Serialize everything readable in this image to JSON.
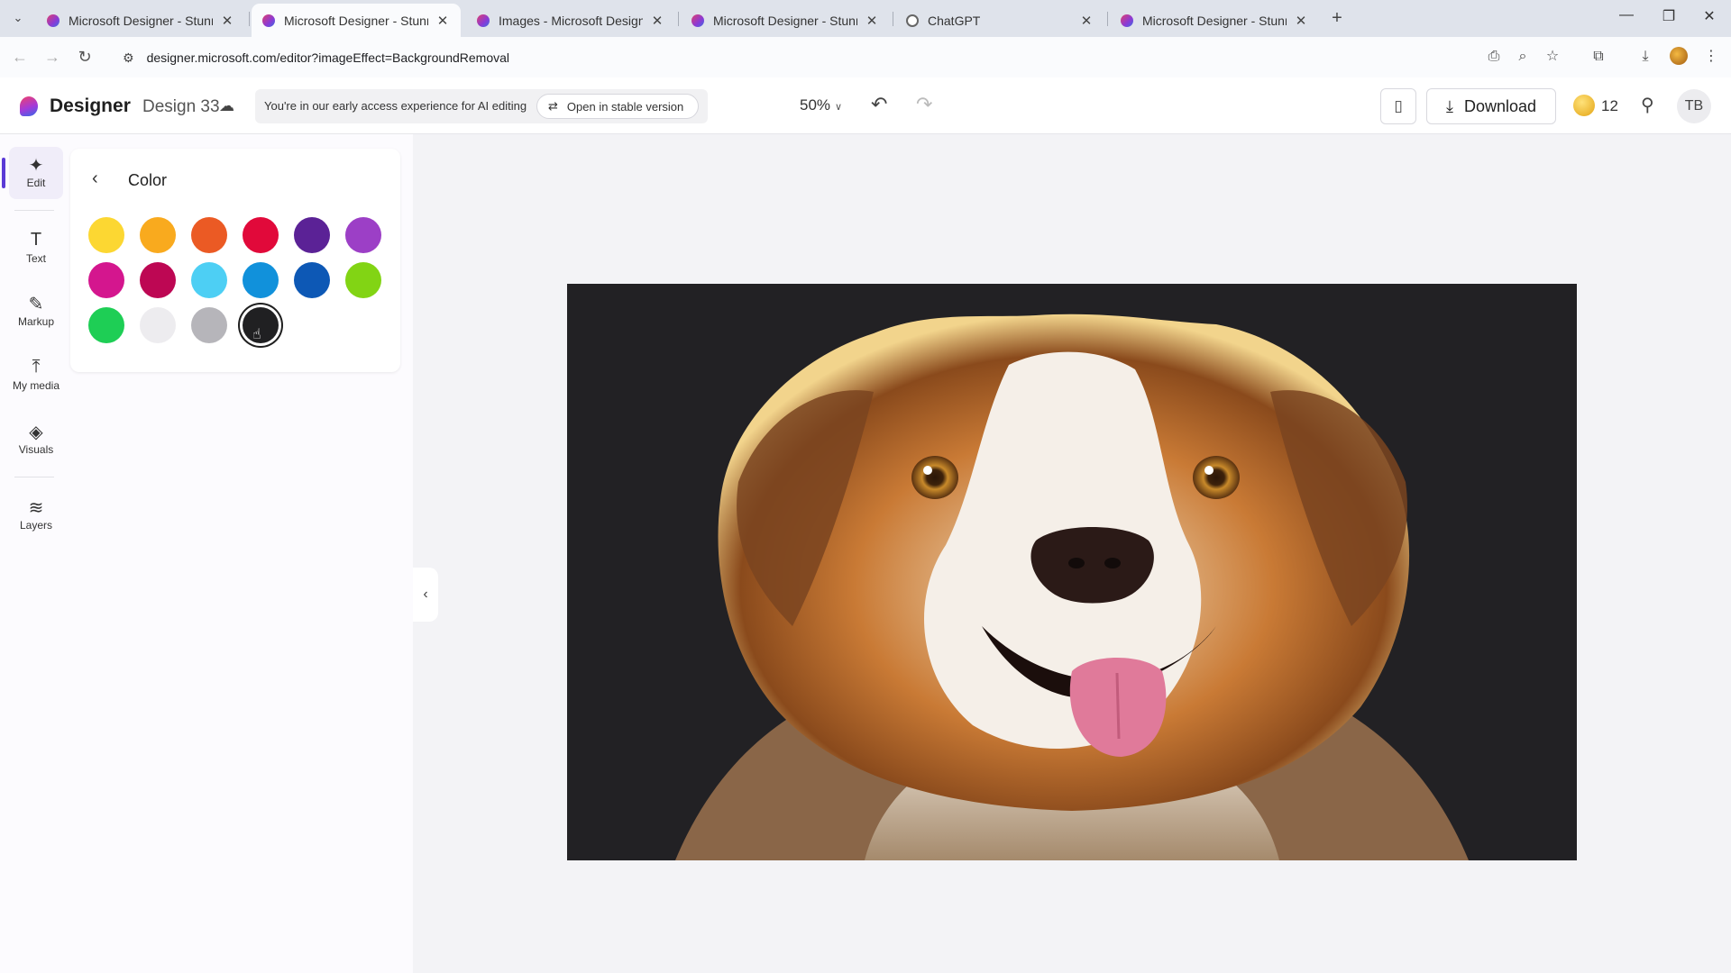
{
  "browser": {
    "tabs": [
      {
        "title": "Microsoft Designer - Stunning",
        "favicon": "designer",
        "active": false
      },
      {
        "title": "Microsoft Designer - Stunning",
        "favicon": "designer",
        "active": true
      },
      {
        "title": "Images - Microsoft Designer",
        "favicon": "designer",
        "active": false
      },
      {
        "title": "Microsoft Designer - Stunning",
        "favicon": "designer",
        "active": false
      },
      {
        "title": "ChatGPT",
        "favicon": "chatgpt",
        "active": false
      },
      {
        "title": "Microsoft Designer - Stunning",
        "favicon": "designer",
        "active": false
      }
    ],
    "url": "designer.microsoft.com/editor?imageEffect=BackgroundRemoval"
  },
  "header": {
    "brand": "Designer",
    "design_name": "Design 33",
    "early_access_text": "You're in our early access experience for AI editing",
    "stable_button": "Open in stable version",
    "zoom": "50%",
    "download_label": "Download",
    "coins": "12",
    "avatar_initials": "TB"
  },
  "rail": {
    "items": [
      {
        "label": "Edit",
        "icon": "sparkle-icon",
        "active": true
      },
      {
        "label": "Text",
        "icon": "text-icon",
        "active": false
      },
      {
        "label": "Markup",
        "icon": "pen-icon",
        "active": false
      },
      {
        "label": "My media",
        "icon": "upload-icon",
        "active": false
      },
      {
        "label": "Visuals",
        "icon": "shapes-icon",
        "active": false
      },
      {
        "label": "Layers",
        "icon": "layers-icon",
        "active": false
      }
    ]
  },
  "color_panel": {
    "title": "Color",
    "swatches": [
      "#FCD732",
      "#F9AA1E",
      "#EB5A24",
      "#E1093A",
      "#5B2296",
      "#9C3FC6",
      "#D4168E",
      "#BD0753",
      "#4DCFF4",
      "#1191DB",
      "#0D58B5",
      "#82D414",
      "#1ECE55",
      "#EDECEF",
      "#B6B5BA",
      "#202022"
    ],
    "selected_index": 15
  },
  "canvas": {
    "image_background": "#222124"
  },
  "colors": {
    "accent": "#5B3BD6"
  }
}
